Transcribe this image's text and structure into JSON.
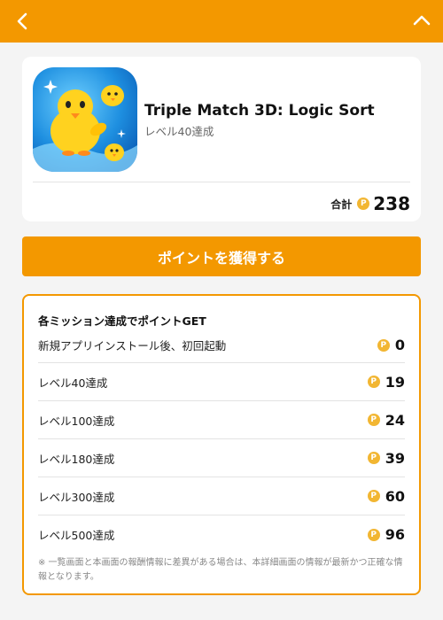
{
  "header": {
    "back_icon": "chevron-left-icon",
    "collapse_icon": "chevron-up-icon",
    "bar_color": "#f39800"
  },
  "app": {
    "title": "Triple Match 3D: Logic Sort",
    "subtitle": "レベル40達成",
    "icon": "yellow-chick-app-icon",
    "total_label": "合計",
    "total_value": "238",
    "coin_symbol": "P"
  },
  "cta": {
    "label": "ポイントを獲得する"
  },
  "missions": {
    "title": "各ミッション達成でポイントGET",
    "items": [
      {
        "label": "新規アプリインストール後、初回起動",
        "points": "0"
      },
      {
        "label": "レベル40達成",
        "points": "19"
      },
      {
        "label": "レベル100達成",
        "points": "24"
      },
      {
        "label": "レベル180達成",
        "points": "39"
      },
      {
        "label": "レベル300達成",
        "points": "60"
      },
      {
        "label": "レベル500達成",
        "points": "96"
      }
    ],
    "note": "※ 一覧画面と本画面の報酬情報に差異がある場合は、本詳細画面の情報が最新かつ正確な情報となります。"
  }
}
